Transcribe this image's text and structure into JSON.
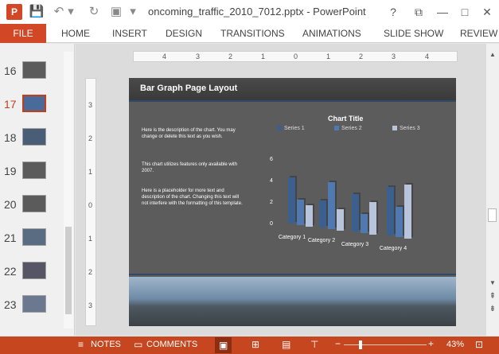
{
  "window": {
    "title": "oncoming_traffic_2010_7012.pptx - PowerPoint",
    "app_icon_label": "P",
    "help": "?",
    "restore": "⧉",
    "minimize": "—",
    "maximize": "□",
    "close": "✕"
  },
  "quick_access": {
    "save": "💾",
    "undo": "↶",
    "undo_dropdown": "▾",
    "redo": "↻",
    "present": "▣",
    "customize": "▾"
  },
  "ribbon": {
    "file": "FILE",
    "tabs": [
      "HOME",
      "INSERT",
      "DESIGN",
      "TRANSITIONS",
      "ANIMATIONS",
      "SLIDE SHOW",
      "REVIEW"
    ]
  },
  "thumbnails": [
    {
      "num": "16"
    },
    {
      "num": "17"
    },
    {
      "num": "18"
    },
    {
      "num": "19"
    },
    {
      "num": "20"
    },
    {
      "num": "21"
    },
    {
      "num": "22"
    },
    {
      "num": "23"
    }
  ],
  "ruler": {
    "labels": [
      "4",
      "3",
      "2",
      "1",
      "0",
      "1",
      "2",
      "3",
      "4"
    ]
  },
  "vruler": {
    "labels": [
      "3",
      "2",
      "1",
      "0",
      "1",
      "2",
      "3"
    ]
  },
  "slide": {
    "title": "Bar Graph Page Layout",
    "para1": "Here is the description of the chart. You may change or delete this text as you wish.",
    "para2": "This chart utilizes features only available with  2007.",
    "para3": "Here is a placeholder for more text and description of the chart.  Changing this text will not interfere with the formatting of this template."
  },
  "chart_data": {
    "type": "bar",
    "title": "Chart Title",
    "categories": [
      "Category 1",
      "Category 2",
      "Category 3",
      "Category 4"
    ],
    "series": [
      {
        "name": "Series 1",
        "values": [
          4.3,
          2.5,
          3.5,
          4.5
        ],
        "color": "#3b5f8f"
      },
      {
        "name": "Series 2",
        "values": [
          2.4,
          4.4,
          1.8,
          2.8
        ],
        "color": "#4f79b0"
      },
      {
        "name": "Series 3",
        "values": [
          2.0,
          2.0,
          3.0,
          5.0
        ],
        "color": "#b7c4dc"
      }
    ],
    "yticks": [
      "0",
      "2",
      "4",
      "6"
    ],
    "ylim": [
      0,
      6
    ],
    "legend": "top"
  },
  "status": {
    "notes": "NOTES",
    "comments": "COMMENTS",
    "zoom_minus": "−",
    "zoom_plus": "+",
    "zoom": "43%"
  },
  "scroll": {
    "up": "▲",
    "down": "▼",
    "prev": "⇞",
    "next": "⇟"
  }
}
